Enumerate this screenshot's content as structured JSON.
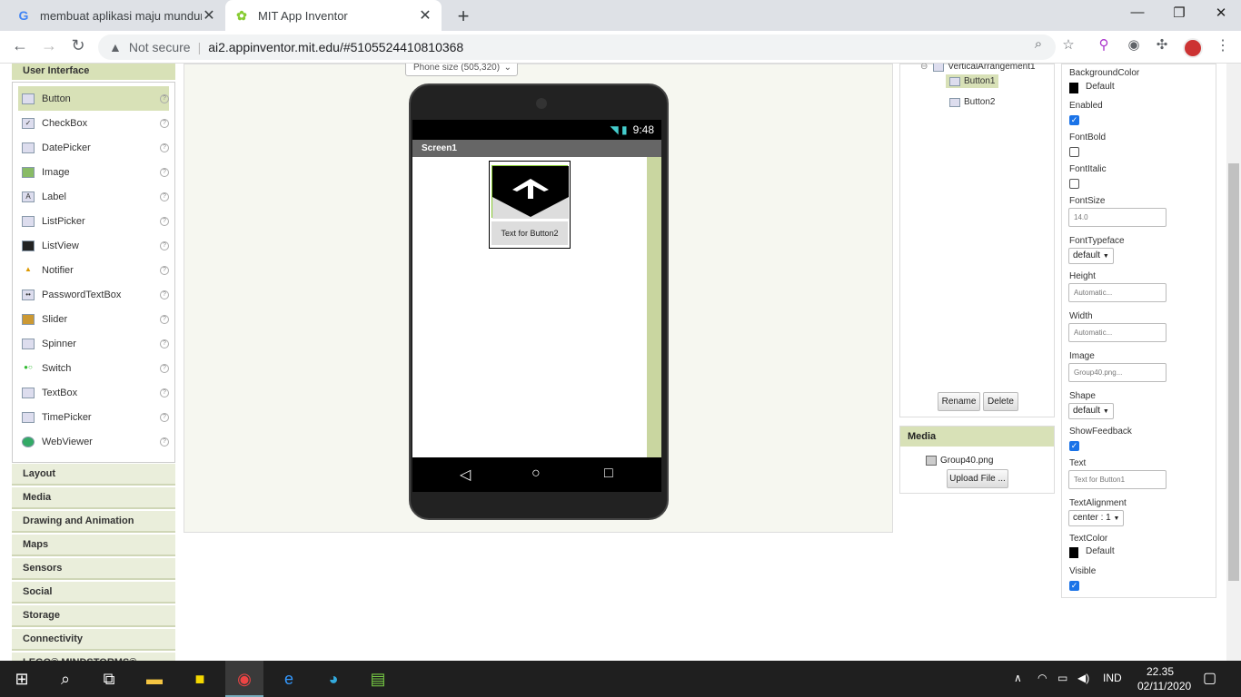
{
  "browser": {
    "tabs": [
      {
        "title": "membuat aplikasi maju mundur l",
        "favicon": "G"
      },
      {
        "title": "MIT App Inventor",
        "favicon": "✿"
      }
    ],
    "address": {
      "security": "Not secure",
      "url": "ai2.appinventor.mit.edu/#5105524410810368"
    }
  },
  "palette": {
    "header": "User Interface",
    "items": [
      {
        "label": "Button",
        "help": "?"
      },
      {
        "label": "CheckBox",
        "help": "?"
      },
      {
        "label": "DatePicker",
        "help": "?"
      },
      {
        "label": "Image",
        "help": "?"
      },
      {
        "label": "Label",
        "help": "?"
      },
      {
        "label": "ListPicker",
        "help": "?"
      },
      {
        "label": "ListView",
        "help": "?"
      },
      {
        "label": "Notifier",
        "help": "?"
      },
      {
        "label": "PasswordTextBox",
        "help": "?"
      },
      {
        "label": "Slider",
        "help": "?"
      },
      {
        "label": "Spinner",
        "help": "?"
      },
      {
        "label": "Switch",
        "help": "?"
      },
      {
        "label": "TextBox",
        "help": "?"
      },
      {
        "label": "TimePicker",
        "help": "?"
      },
      {
        "label": "WebViewer",
        "help": "?"
      }
    ],
    "categories": [
      "Layout",
      "Media",
      "Drawing and Animation",
      "Maps",
      "Sensors",
      "Social",
      "Storage",
      "Connectivity",
      "LEGO® MINDSTORMS®"
    ]
  },
  "viewer": {
    "phone_size": "Phone size (505,320)",
    "clock": "9:48",
    "screen_title": "Screen1",
    "button2_text": "Text for Button2"
  },
  "components": {
    "tree": [
      "VerticalArrangement1",
      "Button1",
      "Button2"
    ],
    "rename": "Rename",
    "delete": "Delete"
  },
  "media": {
    "title": "Media",
    "file": "Group40.png",
    "upload": "Upload File ..."
  },
  "properties": {
    "background_color_label": "BackgroundColor",
    "background_color_value": "Default",
    "enabled_label": "Enabled",
    "fontbold_label": "FontBold",
    "fontitalic_label": "FontItalic",
    "fontsize_label": "FontSize",
    "fontsize_value": "14.0",
    "fonttypeface_label": "FontTypeface",
    "fonttypeface_value": "default",
    "height_label": "Height",
    "height_value": "Automatic...",
    "width_label": "Width",
    "width_value": "Automatic...",
    "image_label": "Image",
    "image_value": "Group40.png...",
    "shape_label": "Shape",
    "shape_value": "default",
    "showfeedback_label": "ShowFeedback",
    "text_label": "Text",
    "text_value": "Text for Button1",
    "textalignment_label": "TextAlignment",
    "textalignment_value": "center : 1",
    "textcolor_label": "TextColor",
    "textcolor_value": "Default",
    "visible_label": "Visible",
    "checked": {
      "enabled": true,
      "fontbold": false,
      "fontitalic": false,
      "showfeedback": true,
      "visible": true
    }
  },
  "taskbar": {
    "language": "IND",
    "time": "22.35",
    "date": "02/11/2020"
  }
}
